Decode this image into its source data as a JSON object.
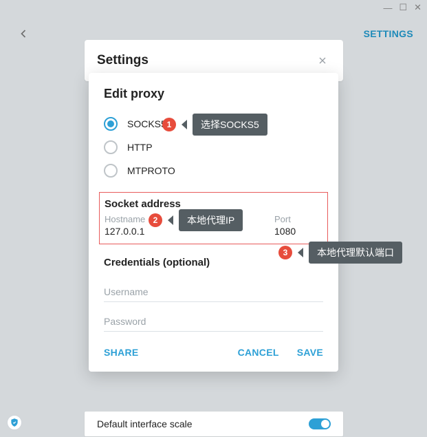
{
  "window": {
    "min": "—",
    "max": "☐",
    "close": "✕"
  },
  "header": {
    "settings_link": "SETTINGS"
  },
  "back_card": {
    "title": "Settings"
  },
  "modal": {
    "title": "Edit proxy",
    "radios": {
      "socks5": "SOCKS5",
      "http": "HTTP",
      "mtproto": "MTPROTO"
    },
    "socket": {
      "heading": "Socket address",
      "hostname_label": "Hostname",
      "hostname_value": "127.0.0.1",
      "port_label": "Port",
      "port_value": "1080"
    },
    "creds": {
      "heading": "Credentials (optional)",
      "username_ph": "Username",
      "password_ph": "Password"
    },
    "actions": {
      "share": "SHARE",
      "cancel": "CANCEL",
      "save": "SAVE"
    }
  },
  "bottom": {
    "label": "Default interface scale"
  },
  "annotations": {
    "a1": {
      "num": "1",
      "text": "选择SOCKS5"
    },
    "a2": {
      "num": "2",
      "text": "本地代理IP"
    },
    "a3": {
      "num": "3",
      "text": "本地代理默认端口"
    }
  }
}
